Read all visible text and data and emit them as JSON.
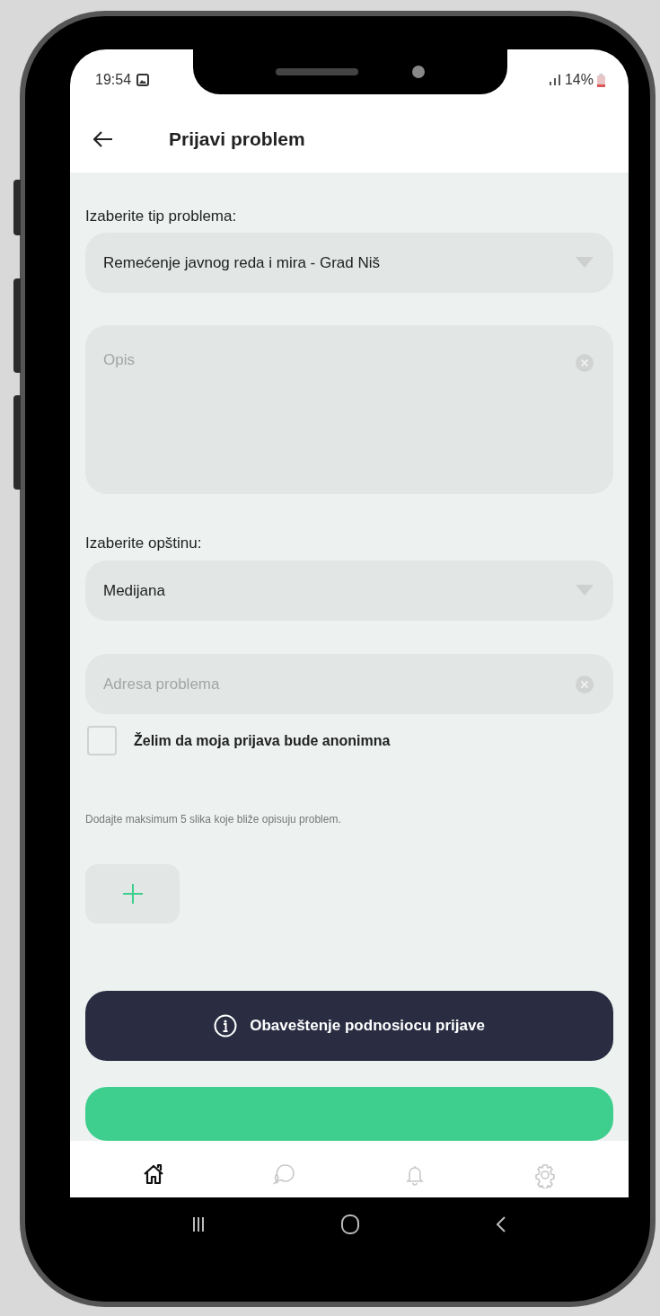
{
  "status_bar": {
    "time": "19:54",
    "battery": "14%"
  },
  "header": {
    "title": "Prijavi problem"
  },
  "form": [
    {
      "kind": "label",
      "text": "Izaberite tip problema:"
    },
    {
      "kind": "select",
      "value": "Remećenje javnog reda i mira - Grad Niš"
    },
    {
      "kind": "textarea",
      "placeholder": "Opis"
    },
    {
      "kind": "label",
      "text": "Izaberite opštinu:"
    },
    {
      "kind": "select",
      "value": "Medijana"
    },
    {
      "kind": "input",
      "placeholder": "Adresa problema"
    },
    {
      "kind": "checkbox",
      "label": "Želim da moja prijava bude anonimna",
      "checked": false
    },
    {
      "kind": "hint",
      "text": "Dodajte maksimum 5 slika koje bliže opisuju problem."
    },
    {
      "kind": "photo_add"
    }
  ],
  "info_button": {
    "label": "Obaveštenje podnosiocu prijave"
  },
  "bottom_nav": [
    {
      "kind": "home",
      "selected": true
    },
    {
      "kind": "chat",
      "selected": false
    },
    {
      "kind": "bell",
      "selected": false
    },
    {
      "kind": "gear",
      "selected": false
    }
  ]
}
